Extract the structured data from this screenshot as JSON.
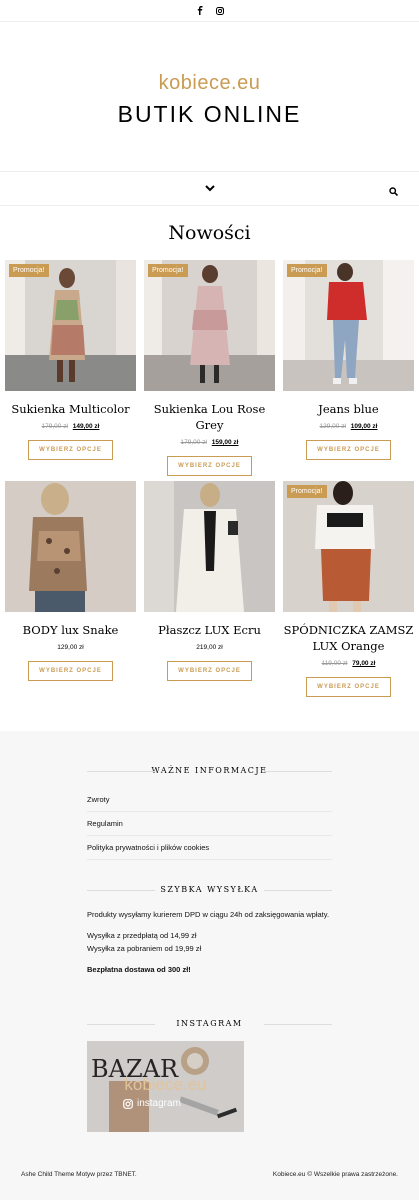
{
  "topbar": {
    "icons": [
      "facebook-icon",
      "instagram-icon"
    ]
  },
  "header": {
    "logo_small": "kobiece.eu",
    "logo_big": "BUTIK ONLINE"
  },
  "nav": {
    "icons": [
      "chevron-down-icon",
      "search-icon"
    ]
  },
  "section_title": "Nowości",
  "products": [
    {
      "name": "Sukienka Multicolor",
      "old_price": "179,00 zł",
      "price": "149,00 zł",
      "badge": "Promocja!",
      "button": "WYBIERZ OPCJE"
    },
    {
      "name": "Sukienka Lou Rose Grey",
      "old_price": "179,00 zł",
      "price": "159,00 zł",
      "badge": "Promocja!",
      "button": "WYBIERZ OPCJE"
    },
    {
      "name": "Jeans blue",
      "old_price": "129,00 zł",
      "price": "109,00 zł",
      "badge": "Promocja!",
      "button": "WYBIERZ OPCJE"
    },
    {
      "name": "BODY lux Snake",
      "old_price": "",
      "price": "129,00 zł",
      "badge": "",
      "button": "WYBIERZ OPCJE"
    },
    {
      "name": "Płaszcz LUX Ecru",
      "old_price": "",
      "price": "219,00 zł",
      "badge": "",
      "button": "WYBIERZ OPCJE"
    },
    {
      "name": "SPÓDNICZKA ZAMSZ LUX Orange",
      "old_price": "119,00 zł",
      "price": "79,00 zł",
      "badge": "Promocja!",
      "button": "WYBIERZ OPCJE"
    }
  ],
  "footer": {
    "info_title": "WAŻNE INFORMACJE",
    "info_links": [
      "Zwroty",
      "Regulamin",
      "Polityka prywatności i plików cookies"
    ],
    "shipping_title": "SZYBKA WYSYŁKA",
    "shipping_p1": "Produkty wysyłamy kurierem DPD w ciągu 24h od zaksięgowania wpłaty.",
    "shipping_p2a": "Wysyłka z przedpłatą od 14,99 zł",
    "shipping_p2b": "Wysyłka za pobraniem od 19,99 zł",
    "shipping_p3": "Bezpłatna dostawa od 300 zł!",
    "instagram_title": "INSTAGRAM",
    "instagram_brand": "kobiece.eu",
    "instagram_label": "instagram",
    "credits_left": "Ashe Child Theme Motyw przez TBNET.",
    "credits_right": "Kobiece.eu © Wszelkie prawa zastrzeżone."
  }
}
